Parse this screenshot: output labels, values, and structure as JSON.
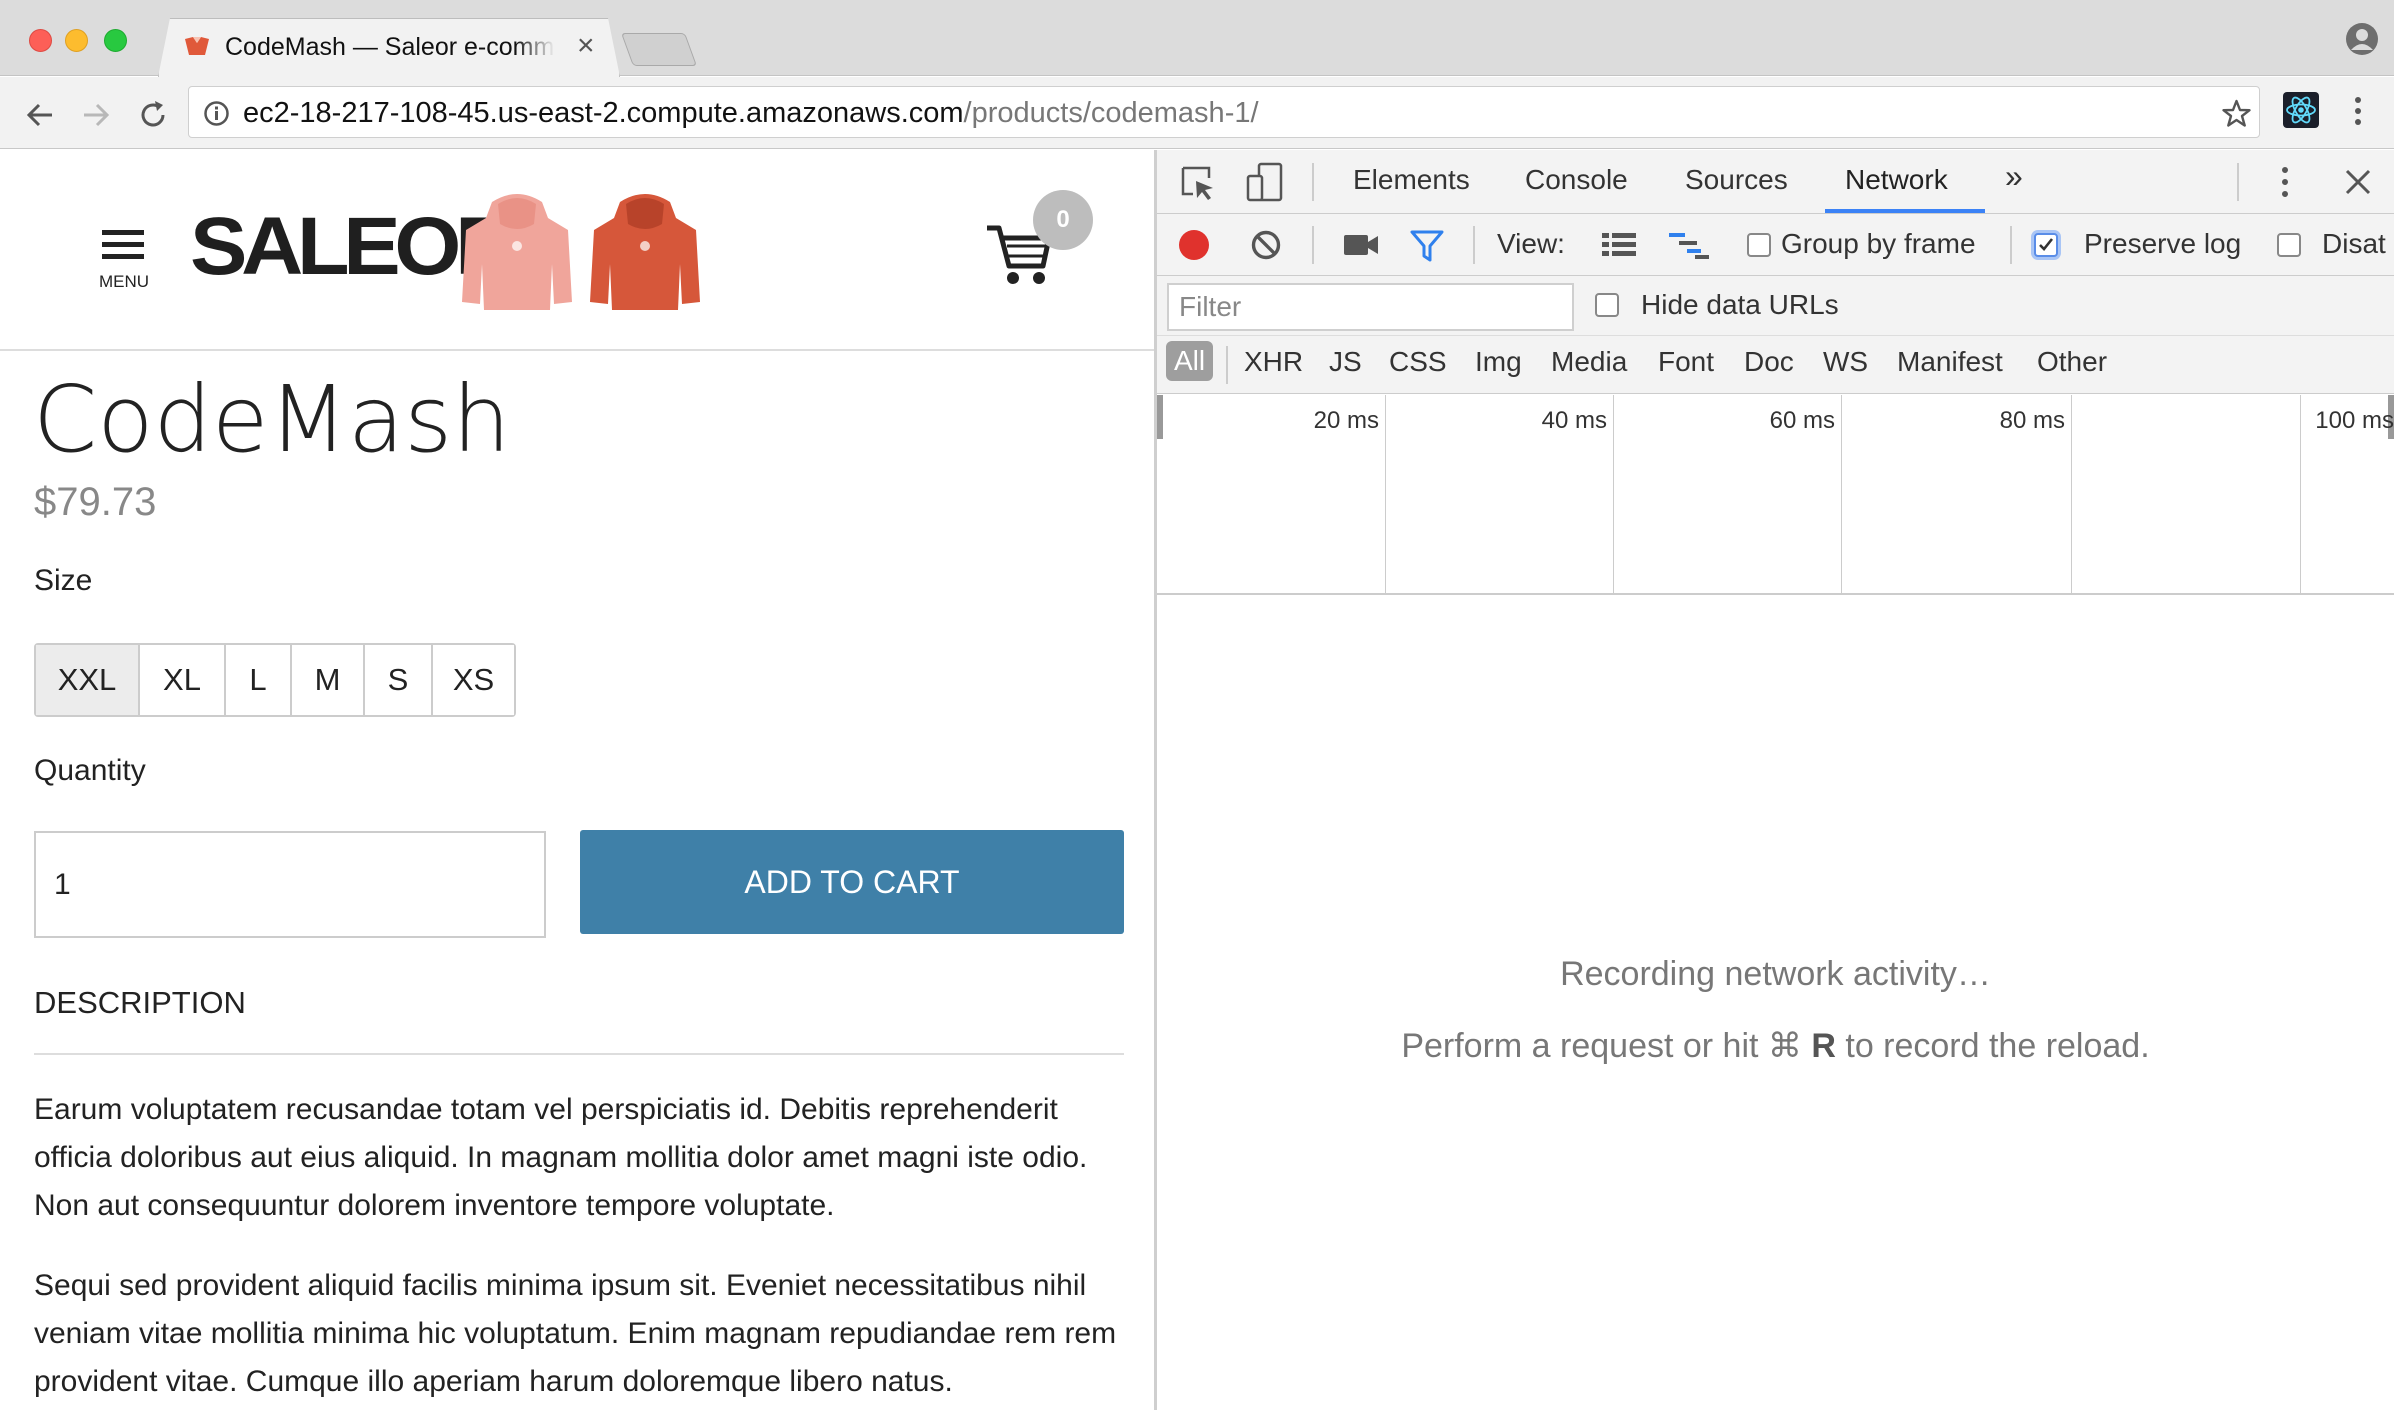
{
  "browser": {
    "tab_title": "CodeMash — Saleor e-comme",
    "url_host": "ec2-18-217-108-45.us-east-2.compute.amazonaws.com",
    "url_path": "/products/codemash-1/"
  },
  "site": {
    "logo_text": "SALEOR",
    "menu_label": "MENU",
    "cart_count": "0"
  },
  "product": {
    "title": "CodeMash",
    "price": "$79.73",
    "size_label": "Size",
    "sizes": [
      "XXL",
      "XL",
      "L",
      "M",
      "S",
      "XS"
    ],
    "selected_size": "XXL",
    "quantity_label": "Quantity",
    "quantity_value": "1",
    "add_to_cart_label": "ADD TO CART",
    "description_heading": "DESCRIPTION",
    "description_paragraphs": [
      "Earum voluptatem recusandae totam vel perspiciatis id. Debitis reprehenderit officia doloribus aut eius aliquid. In magnam mollitia dolor amet magni iste odio. Non aut consequuntur dolorem inventore tempore voluptate.",
      "Sequi sed provident aliquid facilis minima ipsum sit. Eveniet necessitatibus nihil veniam vitae mollitia minima hic voluptatum. Enim magnam repudiandae rem rem provident vitae. Cumque illo aperiam harum doloremque libero natus."
    ]
  },
  "devtools": {
    "tabs": [
      "Elements",
      "Console",
      "Sources",
      "Network"
    ],
    "active_tab": "Network",
    "more_tabs": "»",
    "view_label": "View:",
    "group_by_frame_label": "Group by frame",
    "preserve_log_label": "Preserve log",
    "preserve_log_checked": true,
    "disable_cache_label": "Disat",
    "filter_placeholder": "Filter",
    "hide_data_urls_label": "Hide data URLs",
    "types": [
      "All",
      "XHR",
      "JS",
      "CSS",
      "Img",
      "Media",
      "Font",
      "Doc",
      "WS",
      "Manifest",
      "Other"
    ],
    "timeline_ticks": [
      "20 ms",
      "40 ms",
      "60 ms",
      "80 ms",
      "100 ms"
    ],
    "recording_message": "Recording network activity…",
    "hint_prefix": "Perform a request or hit ⌘ ",
    "hint_key": "R",
    "hint_suffix": " to record the reload."
  },
  "colors": {
    "accent_button": "#3f80a8",
    "record_red": "#e0322d",
    "active_tab_underline": "#3b82f6"
  }
}
